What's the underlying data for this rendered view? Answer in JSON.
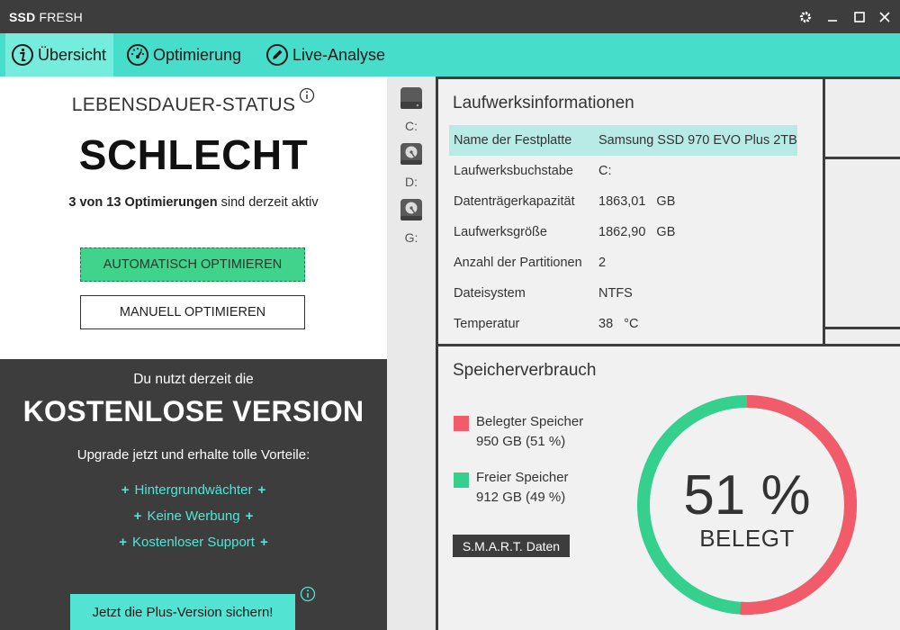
{
  "window": {
    "title_bold": "SSD",
    "title_rest": "FRESH",
    "settings_icon": "gear-icon",
    "minimize_icon": "minimize-icon",
    "maximize_icon": "maximize-icon",
    "close_icon": "close-icon"
  },
  "tabs": [
    {
      "label": "Übersicht",
      "icon": "info-circle-icon",
      "active": true
    },
    {
      "label": "Optimierung",
      "icon": "speedometer-icon",
      "active": false
    },
    {
      "label": "Live-Analyse",
      "icon": "pencil-icon",
      "active": false
    }
  ],
  "status": {
    "title": "LEBENSDAUER-STATUS",
    "value": "SCHLECHT",
    "sub_bold": "3 von 13 Optimierungen",
    "sub_rest": " sind derzeit aktiv",
    "auto_button": "AUTOMATISCH OPTIMIEREN",
    "manual_button": "MANUELL OPTIMIEREN"
  },
  "promo": {
    "line1": "Du nutzt derzeit die",
    "title": "KOSTENLOSE VERSION",
    "line2": "Upgrade jetzt und erhalte tolle Vorteile:",
    "features": [
      "Hintergrundwächter",
      "Keine Werbung",
      "Kostenloser Support"
    ],
    "button": "Jetzt die Plus-Version sichern!"
  },
  "drives": [
    {
      "label": "C:",
      "icon": "ssd-drive-icon",
      "selected": true
    },
    {
      "label": "D:",
      "icon": "hard-disk-icon",
      "selected": false
    },
    {
      "label": "G:",
      "icon": "hard-disk-icon",
      "selected": false
    }
  ],
  "drive_info": {
    "title": "Laufwerksinformationen",
    "rows": [
      {
        "key": "Name der Festplatte",
        "value": "Samsung SSD 970 EVO Plus 2TB",
        "unit": ""
      },
      {
        "key": "Laufwerksbuchstabe",
        "value": "C:",
        "unit": ""
      },
      {
        "key": "Datenträgerkapazität",
        "value": "1863,01",
        "unit": "GB"
      },
      {
        "key": "Laufwerksgröße",
        "value": "1862,90",
        "unit": "GB"
      },
      {
        "key": "Anzahl der Partitionen",
        "value": "2",
        "unit": ""
      },
      {
        "key": "Dateisystem",
        "value": "NTFS",
        "unit": ""
      },
      {
        "key": "Temperatur",
        "value": "38",
        "unit": "°C"
      }
    ]
  },
  "usage": {
    "title": "Speicherverbrauch",
    "used_label": "Belegter Speicher",
    "used_value": "950 GB (51 %)",
    "free_label": "Freier Speicher",
    "free_value": "912 GB (49 %)",
    "smart_button": "S.M.A.R.T. Daten",
    "percent_text": "51 %",
    "percent_caption": "BELEGT",
    "used_fraction": 0.51,
    "used_color": "#f25c6a",
    "free_color": "#35d08e"
  },
  "colors": {
    "accent": "#47ddcb",
    "dark": "#3d3d3d",
    "button_green": "#3fd38c"
  }
}
